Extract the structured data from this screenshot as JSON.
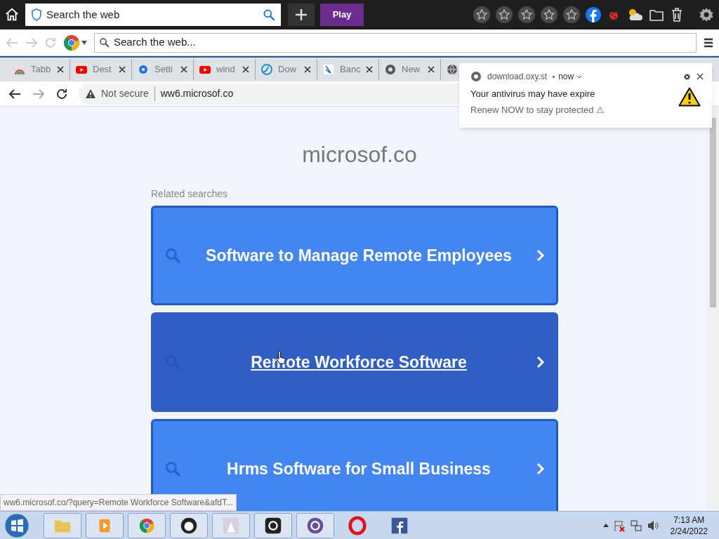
{
  "top_toolbar": {
    "search": {
      "placeholder": "Search the web"
    },
    "play_button": "Play"
  },
  "nav_bar": {
    "search": {
      "placeholder": "Search the web..."
    }
  },
  "tabs": [
    {
      "label": "Tabb"
    },
    {
      "label": "Dest"
    },
    {
      "label": "Setti"
    },
    {
      "label": "wind"
    },
    {
      "label": "Dow"
    },
    {
      "label": "Banc"
    },
    {
      "label": "New"
    }
  ],
  "address_bar": {
    "security": "Not secure",
    "url": "ww6.microsof.co"
  },
  "notification": {
    "source": "download.oxy.st",
    "time": "now",
    "title": "Your antivirus may have expire",
    "message": "Renew NOW to stay protected ⚠"
  },
  "page": {
    "domain": "microsof.co",
    "related_label": "Related searches",
    "results": [
      {
        "label": "Software to Manage Remote Employees",
        "hovered": false
      },
      {
        "label": "Remote Workforce Software",
        "hovered": true
      },
      {
        "label": "Hrms Software for Small Business",
        "hovered": false
      }
    ]
  },
  "status_url": "ww6.microsof.co/?query=Remote Workforce Software&afdT...",
  "taskbar": {
    "time": "7:13 AM",
    "date": "2/24/2022"
  }
}
